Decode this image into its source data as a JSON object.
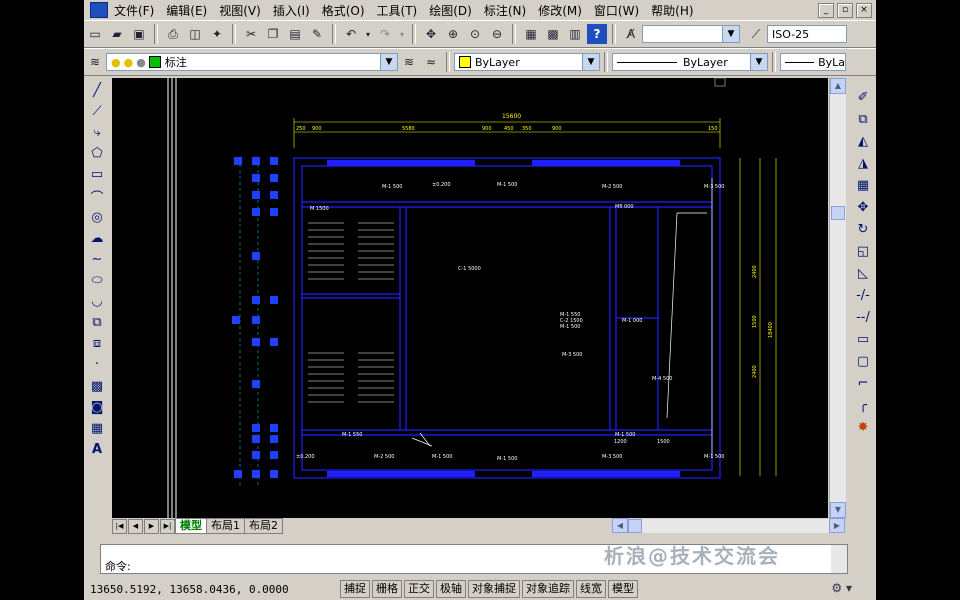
{
  "menu": [
    "文件(F)",
    "编辑(E)",
    "视图(V)",
    "插入(I)",
    "格式(O)",
    "工具(T)",
    "绘图(D)",
    "标注(N)",
    "修改(M)",
    "窗口(W)",
    "帮助(H)"
  ],
  "window_controls": [
    "_",
    "▫",
    "×"
  ],
  "toolbar": {
    "text_style_value": "",
    "dim_style_value": "ISO-25"
  },
  "layers": {
    "current_layer": "标注",
    "color_value": "ByLayer",
    "linetype_value": "ByLayer",
    "lineweight_value": "ByLa"
  },
  "tabs": {
    "nav": [
      "|◀",
      "◀",
      "▶",
      "▶|"
    ],
    "items": [
      "模型",
      "布局1",
      "布局2"
    ],
    "active": "模型"
  },
  "command": {
    "prompt": "命令:"
  },
  "watermark": "析浪@技术交流会",
  "status": {
    "coordinates": "13650.5192, 13658.0436, 0.0000",
    "toggles": [
      "捕捉",
      "栅格",
      "正交",
      "极轴",
      "对象捕捉",
      "对象追踪",
      "线宽",
      "模型"
    ]
  },
  "drawing": {
    "dim_top_total": "15600",
    "dims_top": [
      "250",
      "900",
      "5580",
      "900",
      "450",
      "350",
      "900",
      "150"
    ],
    "dims_right": [
      "2400",
      "1500",
      "2400",
      "18400"
    ],
    "room_labels": [
      "M-1 500",
      "±0.200",
      "M-1 500",
      "M-2 500",
      "M-3 500",
      "Mfl 000",
      "M 1500",
      "C-1 5000",
      "M-1 550",
      "C-2 1500",
      "M-1 500",
      "M-1 000",
      "M-3 500",
      "M-4 500",
      "M-1 550",
      "M-1 500",
      "±0.200",
      "M-1 500",
      "M-2 500",
      "M-1 500",
      "M-3 500",
      "M-1 500",
      "1200",
      "1500"
    ],
    "colors": {
      "wall": "#2020ff",
      "dim": "#ffff00",
      "grid": "#00e0ff",
      "ui_blue": "#1f4fbf"
    }
  }
}
